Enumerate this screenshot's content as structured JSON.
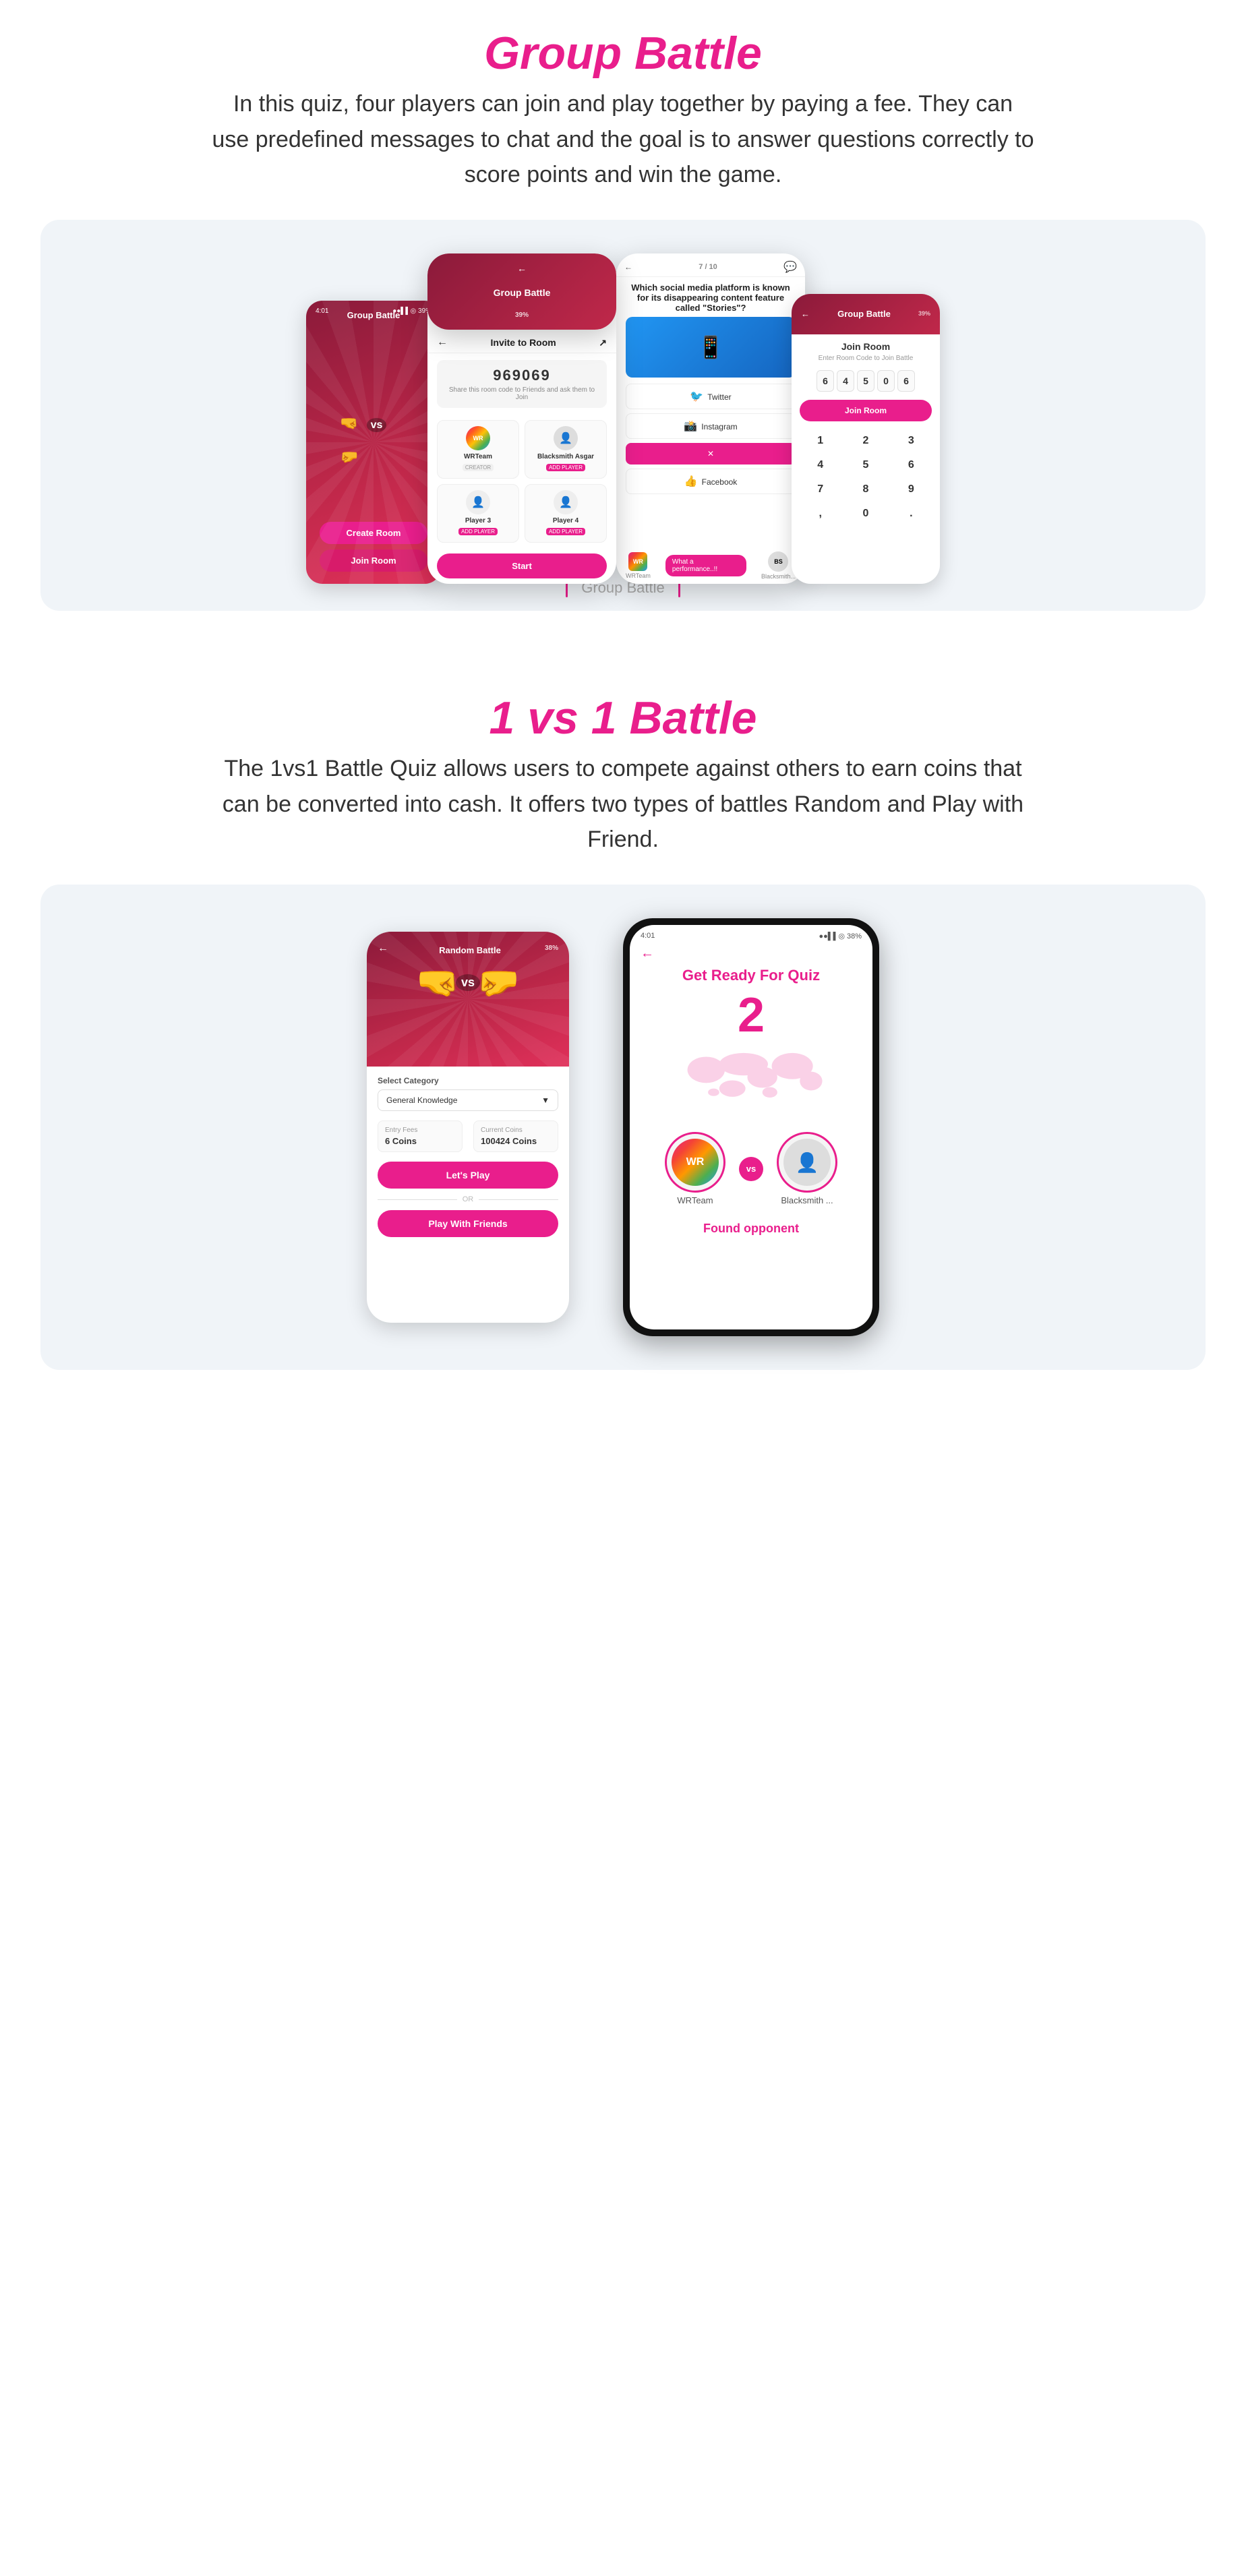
{
  "groupBattle": {
    "title": "Group Battle",
    "description": "In this quiz, four players can join and play together by paying a fee.\nThey can use predefined messages to chat and the goal is to answer\nquestions correctly to score points and win the game.",
    "phone1": {
      "title": "Group Battle",
      "btnCreate": "Create Room",
      "btnJoin": "Join Room"
    },
    "phone2": {
      "topbarTitle": "Group Battle",
      "screenTitle": "Invite to Room",
      "roomCode": "969069",
      "roomCodeHint": "Share this room code to Friends and ask them to Join",
      "players": [
        {
          "name": "WRTeam",
          "role": "CREATOR",
          "hasAvatar": true
        },
        {
          "name": "Blacksmith Asgar",
          "role": "ADD PLAYER",
          "hasAvatar": true
        },
        {
          "name": "Player 3",
          "role": "ADD PLAYER",
          "hasAvatar": false
        },
        {
          "name": "Player 4",
          "role": "ADD PLAYER",
          "hasAvatar": false
        }
      ],
      "btnStart": "Start"
    },
    "phone3": {
      "progress": "7 / 10",
      "question": "Which social media platform is known for its disappearing content feature called \"Stories\"?",
      "answers": [
        {
          "text": "Twitter",
          "state": "normal"
        },
        {
          "text": "Instagram",
          "state": "normal"
        },
        {
          "text": "✕",
          "state": "wrong"
        },
        {
          "text": "Facebook",
          "state": "normal"
        }
      ],
      "chatMessage": "What a performance..!!",
      "chatUser1": "WRTeam",
      "chatUser2": "Blacksmith..."
    },
    "phone4": {
      "topbarTitle": "Group Battle",
      "screenTitle": "Join Room",
      "hint": "Enter Room Code to Join Battle",
      "codeDigits": [
        "6",
        "4",
        "5",
        "0",
        "6"
      ],
      "btnJoin": "Join Room",
      "numpad": [
        "1",
        "2",
        "3",
        "4",
        "5",
        "6",
        "7",
        "8",
        "9",
        ",",
        "0",
        "."
      ]
    },
    "cardLabel": "Group Battle"
  },
  "battle1v1": {
    "title": "1 vs 1 Battle",
    "description": "The 1vs1 Battle Quiz allows users to compete against others to earn coins\nthat can be converted into cash. It offers two types of battles\nRandom and Play with Friend.",
    "phoneLeft": {
      "topbarTitle": "Random Battle",
      "categoryLabel": "Select Category",
      "categoryValue": "General Knowledge",
      "entryFeeLabel": "Entry Fees",
      "entryFeeValue": "6 Coins",
      "currentCoinsLabel": "Current Coins",
      "currentCoinsValue": "100424 Coins",
      "btnLetsPlay": "Let's Play",
      "orText": "OR",
      "btnPlayFriends": "Play With Friends"
    },
    "phoneRight": {
      "screenTitle": "Get Ready For Quiz",
      "countdown": "2",
      "player1Name": "WRTeam",
      "player2Name": "Blacksmith ...",
      "foundText": "Found opponent"
    }
  }
}
